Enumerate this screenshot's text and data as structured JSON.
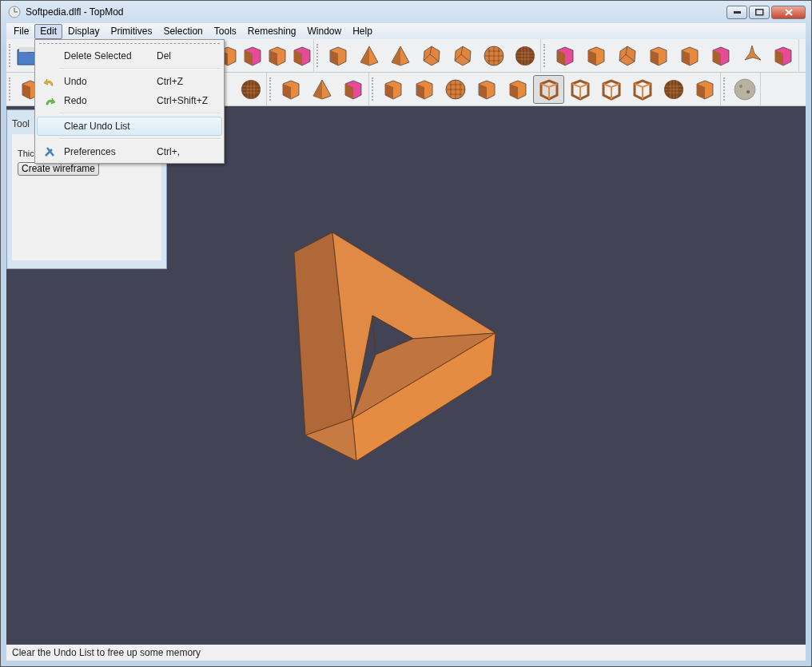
{
  "window": {
    "title": "Softpedia.dlfl - TopMod"
  },
  "menubar": [
    {
      "label": "File",
      "selected": false
    },
    {
      "label": "Edit",
      "selected": true
    },
    {
      "label": "Display",
      "selected": false
    },
    {
      "label": "Primitives",
      "selected": false
    },
    {
      "label": "Selection",
      "selected": false
    },
    {
      "label": "Tools",
      "selected": false
    },
    {
      "label": "Remeshing",
      "selected": false
    },
    {
      "label": "Window",
      "selected": false
    },
    {
      "label": "Help",
      "selected": false
    }
  ],
  "toolbars": [
    [
      [
        {
          "kind": "folder",
          "selected": false
        },
        {
          "kind": "cube",
          "selected": false
        },
        {
          "kind": "pink",
          "selected": false
        },
        {
          "kind": "cube",
          "selected": false
        },
        {
          "kind": "pink",
          "selected": false
        }
      ],
      [
        {
          "kind": "cube",
          "selected": false
        },
        {
          "kind": "pyramid",
          "selected": false
        },
        {
          "kind": "pyramid",
          "selected": false
        },
        {
          "kind": "poly",
          "selected": false
        },
        {
          "kind": "poly",
          "selected": false
        },
        {
          "kind": "ball",
          "selected": false
        },
        {
          "kind": "mesh",
          "selected": false
        }
      ],
      [
        {
          "kind": "pink",
          "selected": false
        },
        {
          "kind": "cube",
          "selected": false
        },
        {
          "kind": "poly",
          "selected": false
        },
        {
          "kind": "cube",
          "selected": false
        },
        {
          "kind": "cube",
          "selected": false
        },
        {
          "kind": "pink",
          "selected": false
        },
        {
          "kind": "star",
          "selected": false
        },
        {
          "kind": "pink",
          "selected": false
        }
      ]
    ],
    [
      [
        {
          "kind": "cube",
          "selected": false
        },
        {
          "kind": "mesh",
          "selected": false
        }
      ],
      [
        {
          "kind": "cube",
          "selected": false
        },
        {
          "kind": "pyramid",
          "selected": false
        },
        {
          "kind": "pink",
          "selected": false
        }
      ],
      [
        {
          "kind": "cube",
          "selected": false
        },
        {
          "kind": "cube",
          "selected": false
        },
        {
          "kind": "ball",
          "selected": false
        },
        {
          "kind": "cube",
          "selected": false
        },
        {
          "kind": "cube",
          "selected": false
        },
        {
          "kind": "frame",
          "selected": true
        },
        {
          "kind": "frame",
          "selected": false
        },
        {
          "kind": "frame",
          "selected": false
        },
        {
          "kind": "frame",
          "selected": false
        },
        {
          "kind": "mesh",
          "selected": false
        },
        {
          "kind": "cube",
          "selected": false
        }
      ],
      [
        {
          "kind": "globe",
          "selected": false
        }
      ]
    ]
  ],
  "tool_panel": {
    "title": "Tool",
    "label": "Thic",
    "button": "Create wireframe"
  },
  "edit_menu": [
    [
      {
        "label": "Delete Selected",
        "shortcut": "Del",
        "kind": "plain",
        "selected": false
      }
    ],
    [
      {
        "label": "Undo",
        "shortcut": "Ctrl+Z",
        "kind": "undo",
        "selected": false
      },
      {
        "label": "Redo",
        "shortcut": "Ctrl+Shift+Z",
        "kind": "redo",
        "selected": false
      }
    ],
    [
      {
        "label": "Clear Undo List",
        "kind": "plain",
        "selected": true
      }
    ],
    [
      {
        "label": "Preferences",
        "shortcut": "Ctrl+,",
        "kind": "tools",
        "selected": false
      }
    ]
  ],
  "status_bar": "Clear the Undo List to free up some memory"
}
